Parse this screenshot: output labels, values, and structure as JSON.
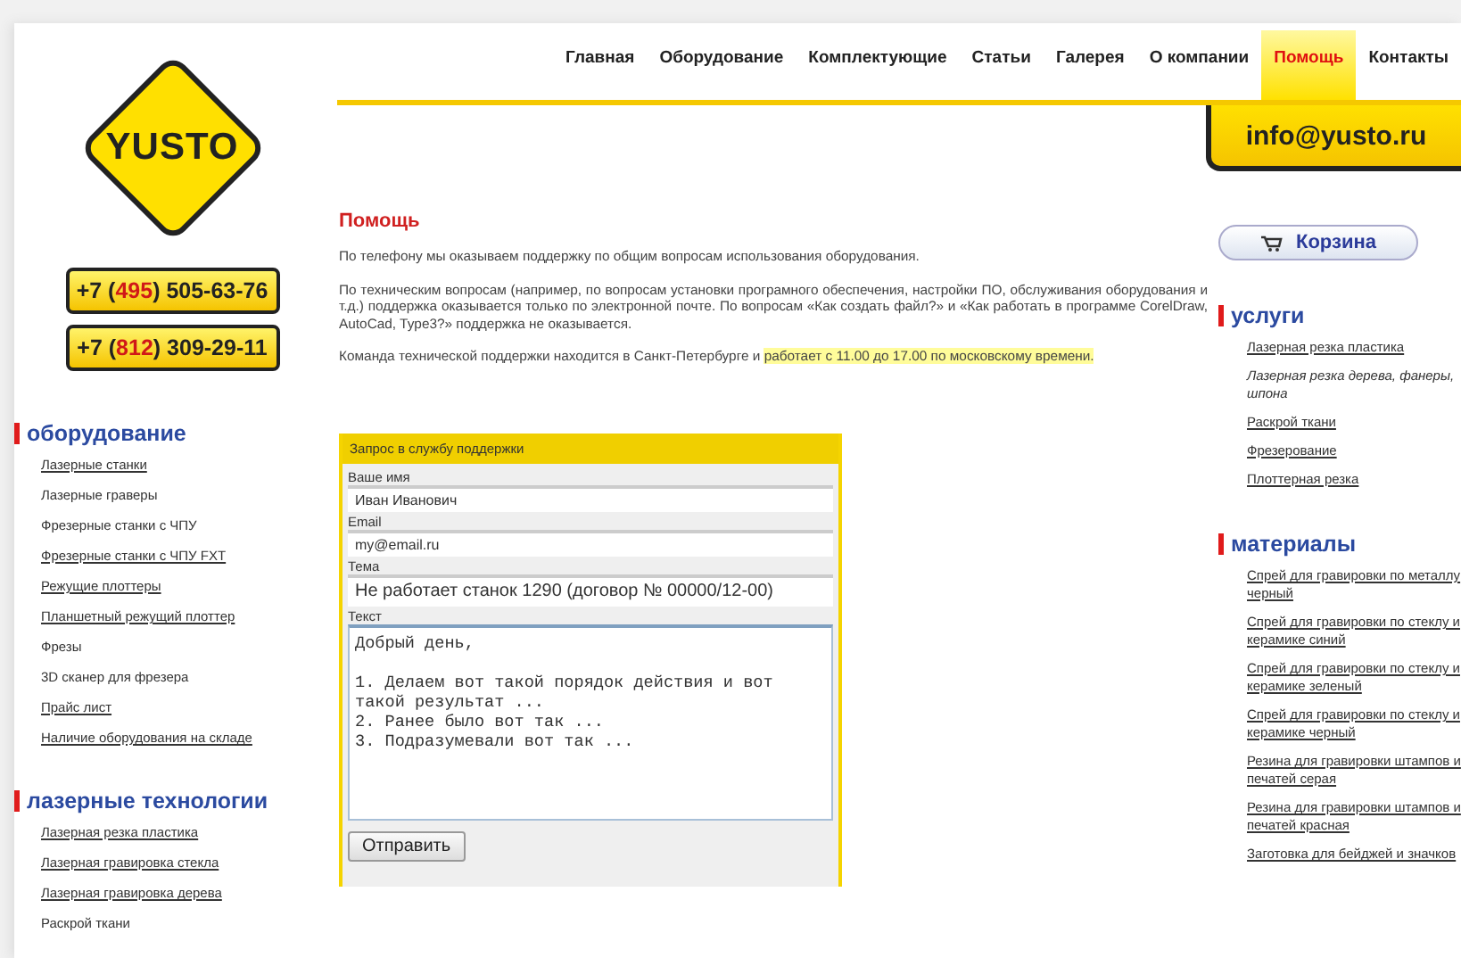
{
  "logo": {
    "text": "YUSTO"
  },
  "phones": [
    {
      "prefix": "+7 (",
      "code": "495",
      "suffix": ") 505-63-76"
    },
    {
      "prefix": "+7 (",
      "code": "812",
      "suffix": ") 309-29-11"
    }
  ],
  "nav": [
    {
      "label": "Главная",
      "selected": false
    },
    {
      "label": "Оборудование",
      "selected": false
    },
    {
      "label": "Комплектующие",
      "selected": false
    },
    {
      "label": "Статьи",
      "selected": false
    },
    {
      "label": "Галерея",
      "selected": false
    },
    {
      "label": "О компании",
      "selected": false
    },
    {
      "label": "Помощь",
      "selected": true
    },
    {
      "label": "Контакты",
      "selected": false
    }
  ],
  "email": "info@yusto.ru",
  "left_sections": [
    {
      "title": "оборудование",
      "items": [
        {
          "label": "Лазерные станки",
          "underlined": true
        },
        {
          "label": "Лазерные граверы",
          "underlined": false
        },
        {
          "label": "Фрезерные станки с ЧПУ",
          "underlined": false
        },
        {
          "label": "Фрезерные станки с ЧПУ FXT",
          "underlined": true
        },
        {
          "label": "Режущие плоттеры",
          "underlined": true
        },
        {
          "label": "Планшетный режущий плоттер",
          "underlined": true
        },
        {
          "label": "Фрезы",
          "underlined": false
        },
        {
          "label": "3D сканер для фрезера",
          "underlined": false
        },
        {
          "label": "Прайс лист",
          "underlined": true
        },
        {
          "label": "Наличие оборудования на складе",
          "underlined": true
        }
      ]
    },
    {
      "title": "лазерные технологии",
      "items": [
        {
          "label": "Лазерная резка пластика",
          "underlined": true
        },
        {
          "label": "Лазерная гравировка стекла",
          "underlined": true
        },
        {
          "label": "Лазерная гравировка дерева",
          "underlined": true
        },
        {
          "label": "Раскрой ткани",
          "underlined": false
        }
      ]
    }
  ],
  "content": {
    "title": "Помощь",
    "paragraphs": [
      {
        "text": "По телефону мы оказываем поддержку по общим вопросам использования оборудования."
      },
      {
        "text": "По техническим вопросам (например, по вопросам установки програмного обеспечения, настройки ПО, обслуживания оборудования и т.д.) поддержка оказывается только по электронной почте. По вопросам «Как создать файл?» и «Как работать в программе CorelDraw, AutoCad, Type3?» поддержка не оказывается."
      },
      {
        "text": "Команда технической поддержки находится в Санкт-Петербурге и ",
        "highlight": "работает с 11.00 до 17.00 по московскому времени."
      }
    ]
  },
  "form": {
    "title": "Запрос в службу поддержки",
    "fields": [
      {
        "label": "Ваше имя",
        "value": "Иван Иванович"
      },
      {
        "label": "Email",
        "value": "my@email.ru"
      },
      {
        "label": "Тема",
        "value": "Не работает станок 1290 (договор № 00000/12-00)"
      }
    ],
    "message": {
      "label": "Текст",
      "value": "Добрый день,\n\n1. Делаем вот такой порядок действия и вот такой результат ...\n2. Ранее было вот так ...\n3. Подразумевали вот так ..."
    },
    "submit": "Отправить"
  },
  "cart": {
    "label": "Корзина"
  },
  "right_sections": [
    {
      "title": "услуги",
      "items": [
        {
          "label": "Лазерная резка пластика",
          "underlined": true
        },
        {
          "label": "Лазерная резка дерева, фанеры, шпона",
          "underlined": false
        },
        {
          "label": "Раскрой ткани",
          "underlined": true
        },
        {
          "label": "Фрезерование",
          "underlined": true
        },
        {
          "label": "Плоттерная резка",
          "underlined": true
        }
      ]
    },
    {
      "title": "материалы",
      "items": [
        {
          "label": "Спрей для гравировки по металлу черный",
          "underlined": true
        },
        {
          "label": "Спрей для гравировки по стеклу и керамике синий",
          "underlined": true
        },
        {
          "label": "Спрей для гравировки по стеклу и керамике зеленый",
          "underlined": true
        },
        {
          "label": "Спрей для гравировки по стеклу и керамике черный",
          "underlined": true
        },
        {
          "label": "Резина для гравировки штампов и печатей серая",
          "underlined": true
        },
        {
          "label": "Резина для гравировки штампов и печатей красная",
          "underlined": true
        },
        {
          "label": "Заготовка для бейджей и значков",
          "underlined": true
        }
      ]
    }
  ]
}
